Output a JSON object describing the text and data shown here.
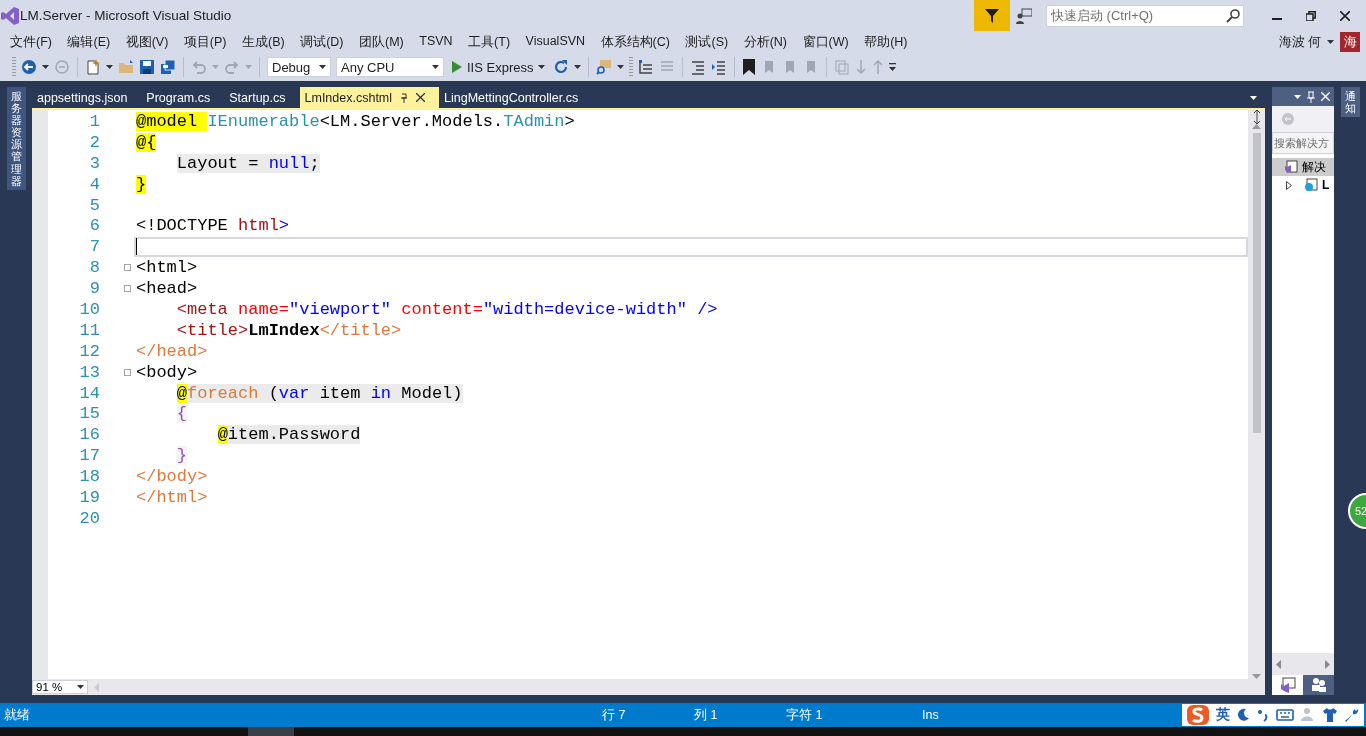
{
  "window": {
    "title": "LM.Server - Microsoft Visual Studio",
    "quick_launch": {
      "placeholder": "快速启动 (Ctrl+Q)"
    },
    "user": "海波 何",
    "avatar": "海"
  },
  "menu": [
    "文件(F)",
    "编辑(E)",
    "视图(V)",
    "项目(P)",
    "生成(B)",
    "调试(D)",
    "团队(M)",
    "TSVN",
    "工具(T)",
    "VisualSVN",
    "体系结构(C)",
    "测试(S)",
    "分析(N)",
    "窗口(W)",
    "帮助(H)"
  ],
  "toolbar": {
    "configuration": "Debug",
    "platform": "Any CPU",
    "run": "IIS Express"
  },
  "left_sidebar": {
    "label": "服务器资源管理器"
  },
  "tabs": [
    {
      "label": "appsettings.json",
      "selected": false
    },
    {
      "label": "Program.cs",
      "selected": false
    },
    {
      "label": "Startup.cs",
      "selected": false
    },
    {
      "label": "LmIndex.cshtml",
      "selected": true
    },
    {
      "label": "LingMettingController.cs",
      "selected": false
    }
  ],
  "editor": {
    "lines": [
      {
        "number": "1",
        "current": false,
        "fold": false,
        "tokens": [
          {
            "text": "@model ",
            "kind": "razor"
          },
          {
            "text": "IEnumerable",
            "kind": "type"
          },
          {
            "text": "<LM.Server.Models.",
            "kind": "plain"
          },
          {
            "text": "TAdmin",
            "kind": "type"
          },
          {
            "text": ">",
            "kind": "plain"
          }
        ]
      },
      {
        "number": "2",
        "current": false,
        "fold": false,
        "tokens": [
          {
            "text": "@{",
            "kind": "razor"
          }
        ]
      },
      {
        "number": "3",
        "current": false,
        "fold": false,
        "tokens": [
          {
            "text": "    Layout = ",
            "kind": "code"
          },
          {
            "text": "null",
            "kind": "code_kw"
          },
          {
            "text": ";",
            "kind": "code"
          }
        ]
      },
      {
        "number": "4",
        "current": false,
        "fold": false,
        "tokens": [
          {
            "text": "}",
            "kind": "razor"
          }
        ]
      },
      {
        "number": "5",
        "current": false,
        "fold": false
      },
      {
        "number": "6",
        "current": false,
        "fold": false,
        "tokens": [
          {
            "text": "<!DOCTYPE ",
            "kind": "plain"
          },
          {
            "text": "html",
            "kind": "tag_open"
          },
          {
            "text": ">",
            "kind": "delim"
          }
        ]
      },
      {
        "number": "7",
        "current": true,
        "fold": false
      },
      {
        "number": "8",
        "current": false,
        "fold": true,
        "tokens": [
          {
            "text": "<html>",
            "kind": "plain"
          }
        ]
      },
      {
        "number": "9",
        "current": false,
        "fold": true,
        "tokens": [
          {
            "text": "<head>",
            "kind": "plain"
          }
        ]
      },
      {
        "number": "10",
        "current": false,
        "fold": false,
        "tokens": [
          {
            "text": "    <meta ",
            "kind": "tag_open"
          },
          {
            "text": "name=",
            "kind": "attr"
          },
          {
            "text": "\"viewport\" ",
            "kind": "str"
          },
          {
            "text": "content=",
            "kind": "attr"
          },
          {
            "text": "\"width=device-width\"",
            "kind": "str"
          },
          {
            "text": " />",
            "kind": "delim"
          }
        ]
      },
      {
        "number": "11",
        "current": false,
        "fold": false,
        "tokens": [
          {
            "text": "    <title>",
            "kind": "tag_open"
          },
          {
            "text": "LmIndex",
            "kind": "bold"
          },
          {
            "text": "</title>",
            "kind": "tag_close"
          }
        ]
      },
      {
        "number": "12",
        "current": false,
        "fold": false,
        "tokens": [
          {
            "text": "</head>",
            "kind": "tag_close"
          }
        ]
      },
      {
        "number": "13",
        "current": false,
        "fold": true,
        "tokens": [
          {
            "text": "<body>",
            "kind": "plain"
          }
        ]
      },
      {
        "number": "14",
        "current": false,
        "fold": false,
        "tokens": [
          {
            "text": "    @",
            "kind": "razor"
          },
          {
            "text": "foreach",
            "kind": "code_ctl"
          },
          {
            "text": " (",
            "kind": "code"
          },
          {
            "text": "var",
            "kind": "code_kw"
          },
          {
            "text": " item ",
            "kind": "code"
          },
          {
            "text": "in",
            "kind": "code_kw"
          },
          {
            "text": " Model)",
            "kind": "code"
          }
        ]
      },
      {
        "number": "15",
        "current": false,
        "fold": false,
        "tokens": [
          {
            "text": "    {",
            "kind": "brace"
          }
        ]
      },
      {
        "number": "16",
        "current": false,
        "fold": false,
        "tokens": [
          {
            "text": "        @",
            "kind": "razor"
          },
          {
            "text": "item.Password",
            "kind": "code"
          }
        ]
      },
      {
        "number": "17",
        "current": false,
        "fold": false,
        "tokens": [
          {
            "text": "    }",
            "kind": "brace"
          }
        ]
      },
      {
        "number": "18",
        "current": false,
        "fold": false,
        "tokens": [
          {
            "text": "</body>",
            "kind": "tag_close"
          }
        ]
      },
      {
        "number": "19",
        "current": false,
        "fold": false,
        "tokens": [
          {
            "text": "</html>",
            "kind": "tag_close"
          }
        ]
      },
      {
        "number": "20",
        "current": false,
        "fold": false
      }
    ],
    "zoom": "91 %"
  },
  "solution_explorer": {
    "search": {
      "placeholder": "搜索解决方"
    },
    "items": [
      {
        "label": "解决",
        "bold": false
      },
      {
        "label": "L",
        "bold": true
      }
    ]
  },
  "right_sidebar": {
    "label": "通知"
  },
  "notification_badge": "52",
  "status_bar": {
    "state": "就绪",
    "line": "行 7",
    "column": "列 1",
    "char": "字符 1",
    "mode": "Ins",
    "ime": "英"
  }
}
